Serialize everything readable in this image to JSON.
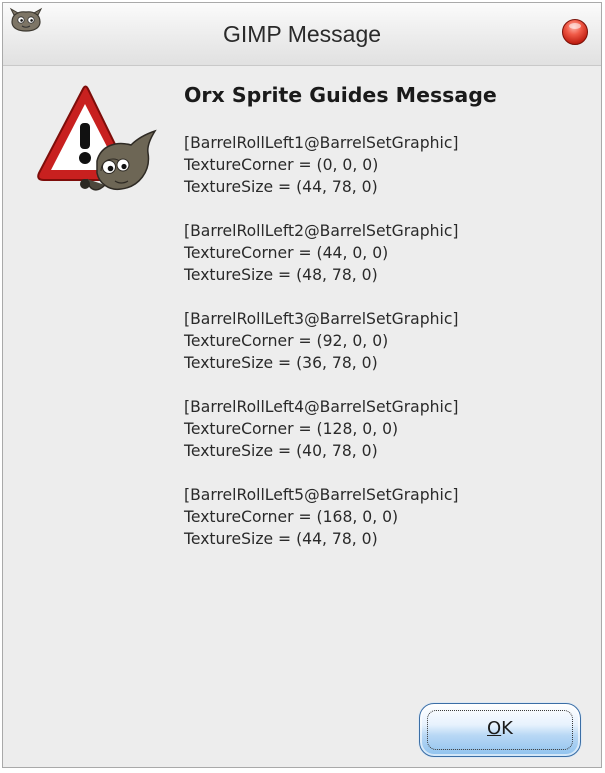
{
  "window": {
    "title": "GIMP Message"
  },
  "message": {
    "heading": "Orx Sprite Guides Message",
    "blocks": [
      {
        "name": "[BarrelRollLeft1@BarrelSetGraphic]",
        "corner": "TextureCorner = (0, 0, 0)",
        "size": "TextureSize = (44, 78, 0)"
      },
      {
        "name": "[BarrelRollLeft2@BarrelSetGraphic]",
        "corner": "TextureCorner = (44, 0, 0)",
        "size": "TextureSize = (48, 78, 0)"
      },
      {
        "name": "[BarrelRollLeft3@BarrelSetGraphic]",
        "corner": "TextureCorner = (92, 0, 0)",
        "size": "TextureSize = (36, 78, 0)"
      },
      {
        "name": "[BarrelRollLeft4@BarrelSetGraphic]",
        "corner": "TextureCorner = (128, 0, 0)",
        "size": "TextureSize = (40, 78, 0)"
      },
      {
        "name": "[BarrelRollLeft5@BarrelSetGraphic]",
        "corner": "TextureCorner = (168, 0, 0)",
        "size": "TextureSize = (44, 78, 0)"
      }
    ]
  },
  "buttons": {
    "ok_mnemonic": "O",
    "ok_rest": "K"
  },
  "icons": {
    "app": "gimp-wilber-icon",
    "close": "close-icon",
    "warning": "warning-icon"
  },
  "colors": {
    "close_button": "#d0301f",
    "warning_red": "#c8201f",
    "ok_button": "#a9d1f4"
  }
}
